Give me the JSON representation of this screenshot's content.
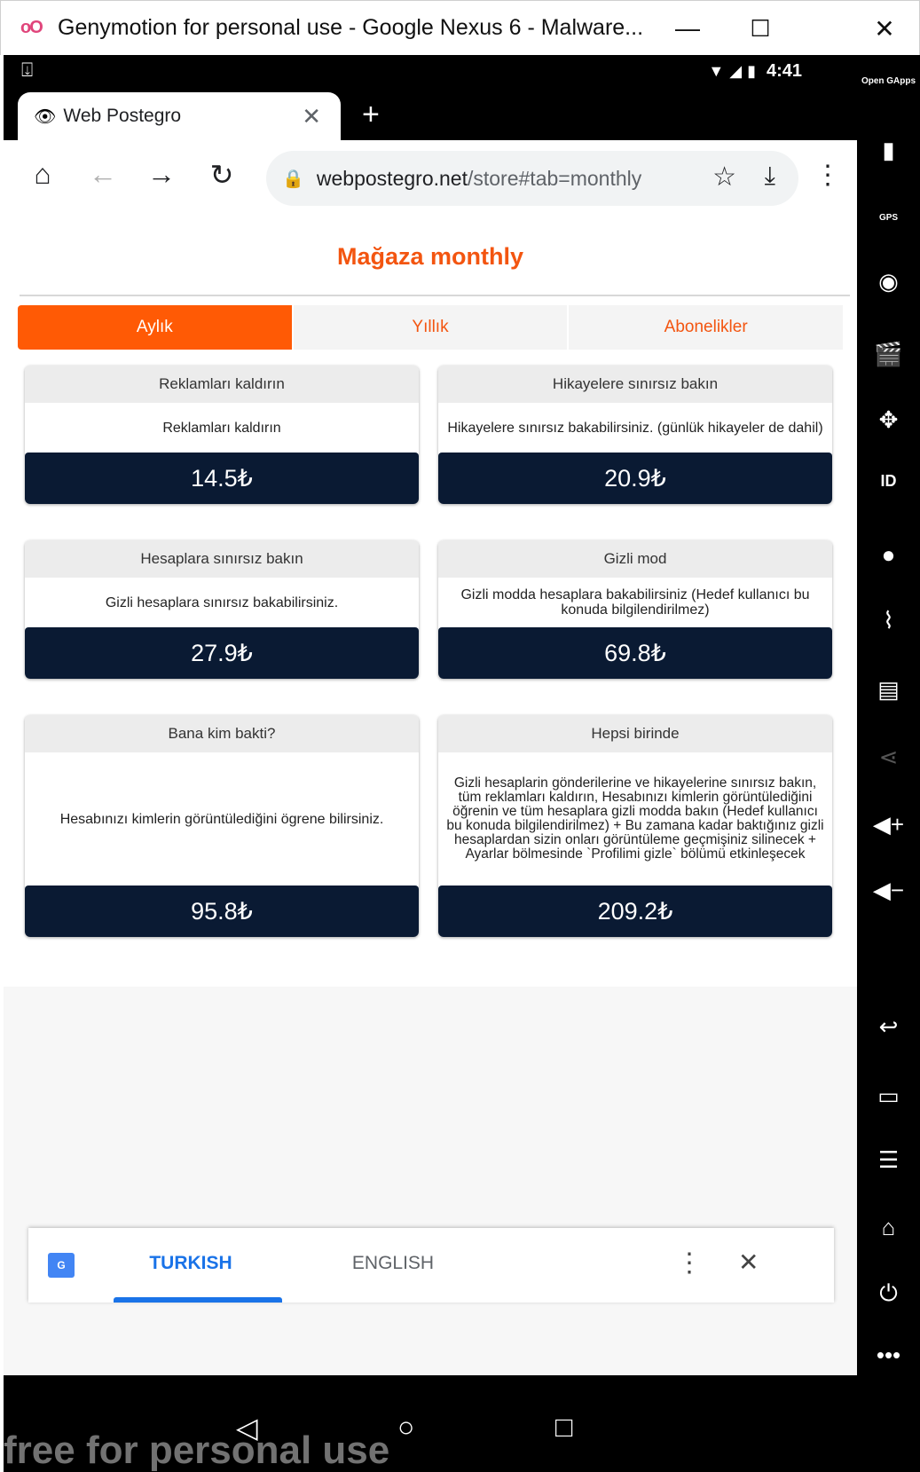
{
  "window": {
    "title": "Genymotion for personal use - Google Nexus 6 - Malware...",
    "minimize_icon": "—",
    "maximize_icon": "☐",
    "close_icon": "✕"
  },
  "statusbar": {
    "time": "4:41"
  },
  "browser": {
    "tab_title": "Web Postegro",
    "url_host": "webpostegro.net",
    "url_path": "/store#tab=monthly"
  },
  "page": {
    "title": "Mağaza monthly",
    "tabs": [
      {
        "label": "Aylık",
        "active": true
      },
      {
        "label": "Yıllık",
        "active": false
      },
      {
        "label": "Abonelikler",
        "active": false
      }
    ],
    "cards": [
      {
        "title": "Reklamları kaldırın",
        "description": "Reklamları kaldırın",
        "price": "14.5₺"
      },
      {
        "title": "Hikayelere sınırsız bakın",
        "description": "Hikayelere sınırsız bakabilirsiniz. (günlük hikayeler de dahil)",
        "price": "20.9₺"
      },
      {
        "title": "Hesaplara sınırsız bakın",
        "description": "Gizli hesaplara sınırsız bakabilirsiniz.",
        "price": "27.9₺"
      },
      {
        "title": "Gizli mod",
        "description": "Gizli modda hesaplara bakabilirsiniz (Hedef kullanıcı bu konuda bilgilendirilmez)",
        "price": "69.8₺"
      },
      {
        "title": "Bana kim bakti?",
        "description": "Hesabınızı kimlerin görüntülediğini ögrene bilirsiniz.",
        "price": "95.8₺"
      },
      {
        "title": "Hepsi birinde",
        "description": "Gizli hesaplarin gönderilerine ve hikayelerine sınırsız bakın, tüm reklamları kaldırın, Hesabınızı kimlerin görüntülediğini öğrenin ve tüm hesaplara gizli modda bakın (Hedef kullanıcı bu konuda bilgilendirilmez) + Bu zamana kadar baktığınız gizli hesaplardan sizin onları görüntüleme geçmişiniz silinecek + Ayarlar bölmesinde `Profilimi gizle` bölümü etkinleşecek",
        "price": "209.2₺"
      }
    ]
  },
  "translate_bar": {
    "lang_source": "TURKISH",
    "lang_target": "ENGLISH"
  },
  "watermark": "free for personal use",
  "sidebar": {
    "opengapps": "Open GApps",
    "gps": "GPS",
    "id": "ID"
  },
  "colors": {
    "accent": "#ff5a05",
    "title_orange": "#f35510",
    "price_bg": "#0a1a33",
    "translate_blue": "#1a73e8"
  }
}
